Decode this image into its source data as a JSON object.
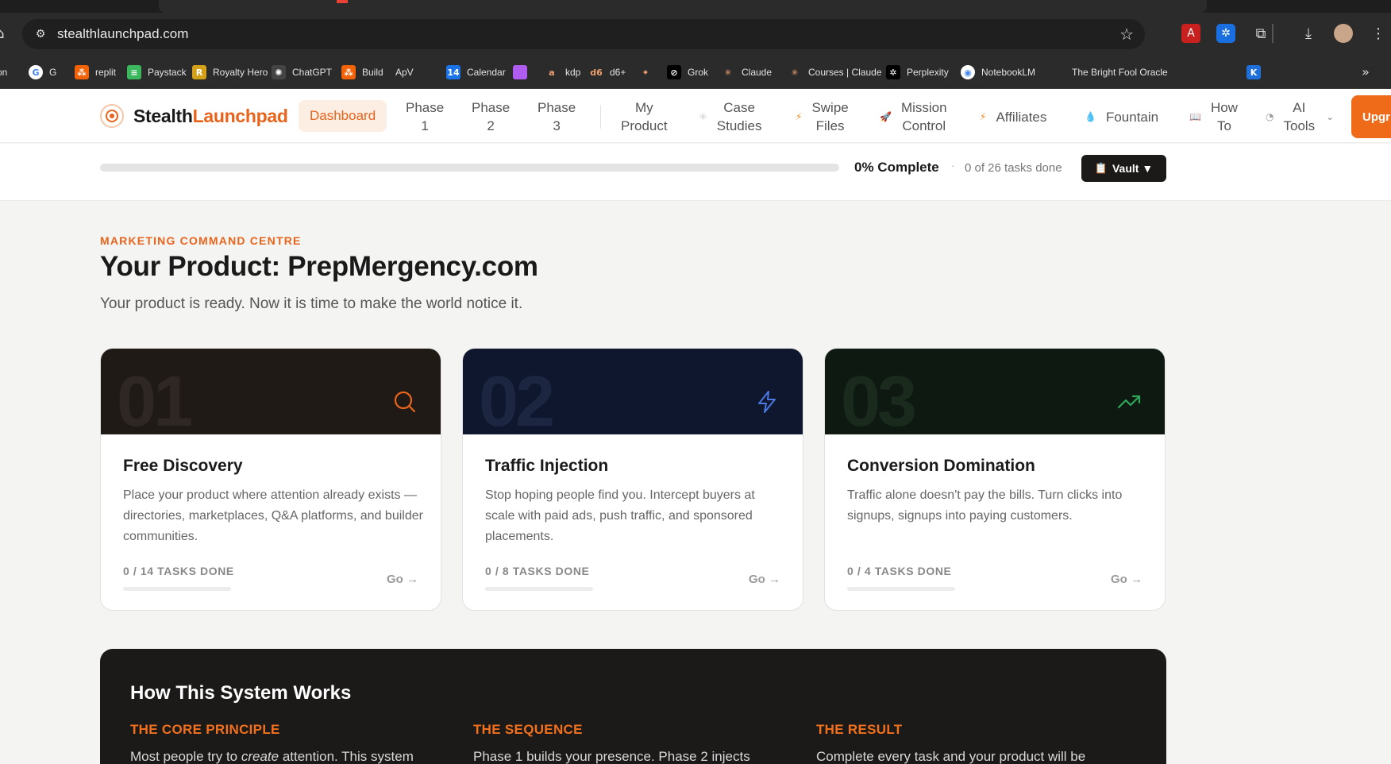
{
  "browser": {
    "url": "stealthlaunchpad.com",
    "bookmarks": [
      {
        "label": "on",
        "icon": "",
        "color": "#2b2b2b"
      },
      {
        "label": "G",
        "icon": "G",
        "color": "#ffffff"
      },
      {
        "label": "replit",
        "icon": "⁂",
        "color": "#f26207"
      },
      {
        "label": "Paystack",
        "icon": "≡",
        "color": "#3bb75e"
      },
      {
        "label": "Royalty Hero",
        "icon": "R",
        "color": "#d4a017"
      },
      {
        "label": "ChatGPT",
        "icon": "✺",
        "color": "#444444"
      },
      {
        "label": "Build",
        "icon": "⁂",
        "color": "#f26207"
      },
      {
        "label": "ApV",
        "icon": "",
        "color": "#ff4500"
      },
      {
        "label": "Calendar",
        "icon": "14",
        "color": "#1a73e8"
      },
      {
        "label": "",
        "icon": "",
        "color": "#b05cf0"
      },
      {
        "label": "kdp",
        "icon": "a",
        "color": "#2b2b2b"
      },
      {
        "label": "d6+",
        "icon": "d6",
        "color": "#2b2b2b"
      },
      {
        "label": "",
        "icon": "✦",
        "color": "#2b2b2b"
      },
      {
        "label": "Grok",
        "icon": "⊘",
        "color": "#000000"
      },
      {
        "label": "Claude",
        "icon": "✳",
        "color": "#2b2b2b"
      },
      {
        "label": "Courses | Claude",
        "icon": "✳",
        "color": "#2b2b2b"
      },
      {
        "label": "Perplexity",
        "icon": "✲",
        "color": "#000000"
      },
      {
        "label": "NotebookLM",
        "icon": "◉",
        "color": "#ffffff"
      },
      {
        "label": "The Bright Fool Oracle",
        "icon": "",
        "color": "#ff4500"
      },
      {
        "label": "",
        "icon": "K",
        "color": "#1e6fd9"
      }
    ]
  },
  "header": {
    "brand_a": "Stealth",
    "brand_b": "Launchpad",
    "dashboard": "Dashboard",
    "nav": [
      {
        "label": "Phase\n1",
        "icon": ""
      },
      {
        "label": "Phase\n2",
        "icon": ""
      },
      {
        "label": "Phase\n3",
        "icon": ""
      },
      {
        "label": "My\nProduct",
        "icon": ""
      },
      {
        "label": "Case\nStudies",
        "icon": "⚛"
      },
      {
        "label": "Swipe\nFiles",
        "icon": "⚡"
      },
      {
        "label": "Mission\nControl",
        "icon": "🚀"
      },
      {
        "label": "Affiliates",
        "icon": "⚡"
      },
      {
        "label": "Fountain",
        "icon": "💧"
      },
      {
        "label": "How\nTo",
        "icon": "📖"
      },
      {
        "label": "AI\nTools",
        "icon": "◔"
      }
    ],
    "upgrade": "Upgr"
  },
  "progress": {
    "percent_label": "0% Complete",
    "separator": "·",
    "tasks_label": "0 of 26 tasks done",
    "fraction": 0,
    "vault_label": "Vault ▼"
  },
  "main": {
    "eyebrow": "MARKETING COMMAND CENTRE",
    "title": "Your Product: PrepMergency.com",
    "subtitle": "Your product is ready. Now it is time to make the world notice it."
  },
  "cards": [
    {
      "num": "01",
      "title": "Free Discovery",
      "desc": "Place your product where attention already exists — directories, marketplaces, Q&A platforms, and builder communities.",
      "tasks": "0 / 14 TASKS DONE",
      "go": "Go →",
      "bg": "#201a17",
      "numcolor": "#2e2724",
      "iconcolor": "#e8641c",
      "icon": "search-icon"
    },
    {
      "num": "02",
      "title": "Traffic Injection",
      "desc": "Stop hoping people find you. Intercept buyers at scale with paid ads, push traffic, and sponsored placements.",
      "tasks": "0 / 8 TASKS DONE",
      "go": "Go →",
      "bg": "#0f172e",
      "numcolor": "#1c2640",
      "iconcolor": "#4a78e0",
      "icon": "lightning-icon"
    },
    {
      "num": "03",
      "title": "Conversion Domination",
      "desc": "Traffic alone doesn't pay the bills. Turn clicks into signups, signups into paying customers.",
      "tasks": "0 / 4 TASKS DONE",
      "go": "Go →",
      "bg": "#0e1a11",
      "numcolor": "#1a2a1d",
      "iconcolor": "#2fa55a",
      "icon": "trending-up-icon"
    }
  ],
  "how": {
    "title": "How This System Works",
    "cols": [
      {
        "heading": "THE CORE PRINCIPLE",
        "text_a": "Most people try to ",
        "text_em": "create",
        "text_b": " attention. This system"
      },
      {
        "heading": "THE SEQUENCE",
        "text_a": "Phase 1 builds your presence. Phase 2 injects",
        "text_em": "",
        "text_b": ""
      },
      {
        "heading": "THE RESULT",
        "text_a": "Complete every task and your product will be",
        "text_em": "",
        "text_b": ""
      }
    ]
  },
  "colors": {
    "accent": "#e8641c",
    "dark": "#1c1a18"
  }
}
